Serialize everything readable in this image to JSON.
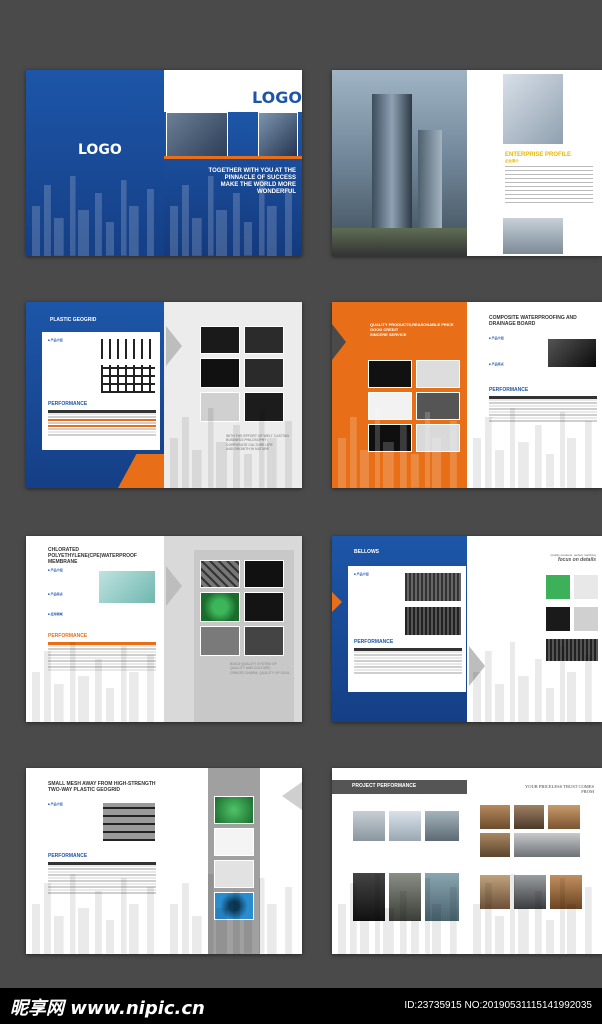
{
  "spread1": {
    "left_logo": "LOGO",
    "right_logo": "LOGO",
    "tagline_lines": [
      "TOGETHER WITH YOU AT THE",
      "PINNACLE OF SUCCESS",
      "MAKE THE WORLD MORE",
      "WONDERFUL"
    ]
  },
  "spread2": {
    "heading": "ENTERPRISE PROFILE",
    "subheading": "企业简介"
  },
  "spread3": {
    "heading": "PLASTIC GEOGRID",
    "performance": "PERFORMANCE",
    "tagline_lines": [
      "WITH THE EFFORT OF WELT CASTING",
      "BUSINESS PHILOSOPHY",
      "CORPORATE CULTURE LIFE",
      "AND GROWTH IN NATURE"
    ]
  },
  "spread4": {
    "tagline_lines": [
      "QUALITY PRODUCTS,REASONABLE PRICE",
      "GOOD CREDIT",
      "SINCERE SERVICE"
    ],
    "heading_lines": [
      "COMPOSITE WATERPROOFING AND",
      "DRAINAGE BOARD"
    ],
    "performance": "PERFORMANCE"
  },
  "spread5": {
    "heading_lines": [
      "CHLORATED POLYETHYLENE(CPE)WATERPROOF",
      "MEMBRANE"
    ],
    "performance": "PERFORMANCE",
    "tagline_lines": [
      "BUILD QUALITY SYSTEM OF",
      "QUALITY AND CULTURE,",
      "CREATE CHARM, QUALITY OF SOUL"
    ]
  },
  "spread6": {
    "heading": "BELLOWS",
    "performance": "PERFORMANCE",
    "focus_small": "Quality products, perfect matching",
    "focus": "focus on details"
  },
  "spread7": {
    "heading_lines": [
      "SMALL MESH AWAY FROM HIGH-STRENGTH",
      "TWO-WAY PLASTIC GEOGRID"
    ],
    "performance": "PERFORMANCE"
  },
  "spread8": {
    "heading": "PROJECT PERFORMANCE",
    "trust_lines": [
      "YOUR PRICELESS TRUST COMES",
      "FROM"
    ]
  },
  "footer": {
    "site_logo": "昵享网 www.nipic.cn",
    "id_text": "ID:23735915 NO:20190531115141992035"
  },
  "colors": {
    "blue": "#1d56a8",
    "orange": "#e86f17",
    "background": "#4a4a4a"
  }
}
